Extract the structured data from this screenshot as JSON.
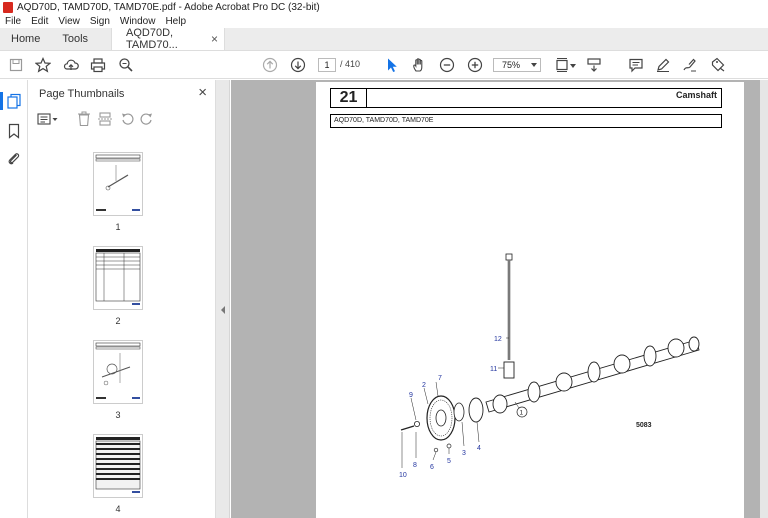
{
  "window": {
    "title": "AQD70D, TAMD70D, TAMD70E.pdf - Adobe Acrobat Pro DC (32-bit)"
  },
  "menu": {
    "items": [
      "File",
      "Edit",
      "View",
      "Sign",
      "Window",
      "Help"
    ]
  },
  "tabs": {
    "home": "Home",
    "tools": "Tools",
    "document": "AQD70D, TAMD70...",
    "close": "×"
  },
  "toolbar": {
    "page_current": "1",
    "page_total": "/ 410",
    "zoom": "75%"
  },
  "panel": {
    "title": "Page Thumbnails",
    "close": "×",
    "thumbnails": [
      {
        "label": "1"
      },
      {
        "label": "2"
      },
      {
        "label": "3"
      },
      {
        "label": "4"
      }
    ]
  },
  "document_page": {
    "section_number": "21",
    "section_title": "Camshaft",
    "models": "AQD70D, TAMD70D, TAMD70E",
    "figure_code": "5083",
    "callouts": [
      "1",
      "2",
      "3",
      "4",
      "5",
      "6",
      "7",
      "8",
      "9",
      "10",
      "11",
      "12"
    ]
  },
  "colors": {
    "accent": "#1473e6",
    "app_red": "#d7291f",
    "viewer_bg": "#b3b3b3"
  }
}
